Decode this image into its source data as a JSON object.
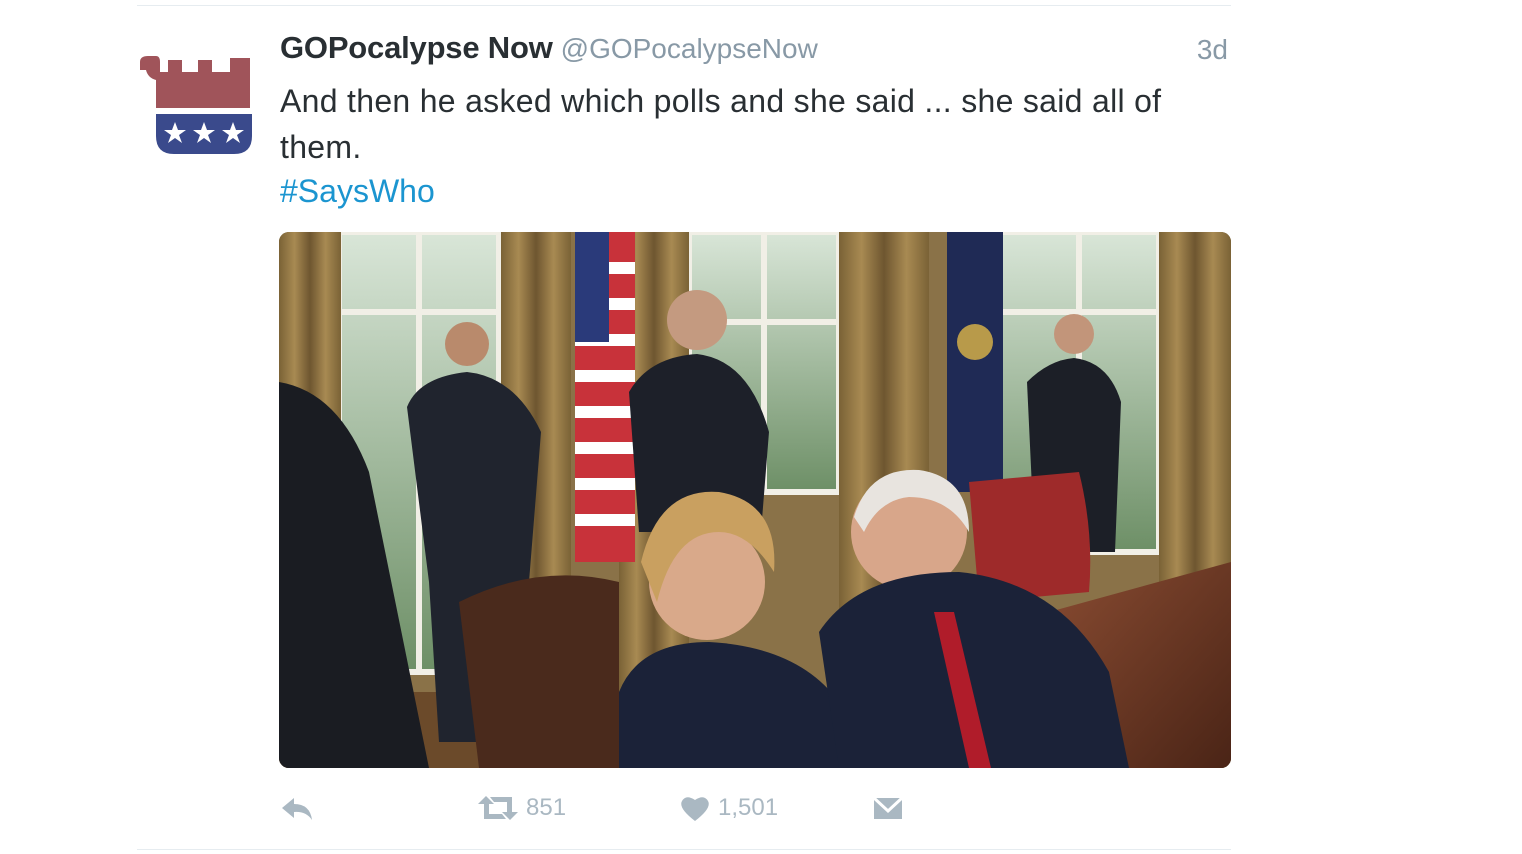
{
  "tweet": {
    "display_name": "GOPocalypse Now",
    "handle": "@GOPocalypseNow",
    "timestamp": "3d",
    "text": "And then he asked which polls and she said ... she said all of them.",
    "hashtag": "#SaysWho"
  },
  "avatar": {
    "icon": "gop-elephant-logo-icon",
    "colors": {
      "body": "#a0545a",
      "band": "#3a4a8c",
      "stars": "#ffffff"
    }
  },
  "media": {
    "icon": "tweet-photo"
  },
  "actions": {
    "reply": {
      "icon": "reply-icon"
    },
    "retweet": {
      "icon": "retweet-icon",
      "count": "851"
    },
    "like": {
      "icon": "heart-icon",
      "count": "1,501"
    },
    "dm": {
      "icon": "envelope-icon"
    }
  },
  "colors": {
    "text": "#292f33",
    "secondary": "#8899a6",
    "link": "#1b95d0",
    "action": "#aab8c2",
    "divider": "#e6ecf0"
  }
}
